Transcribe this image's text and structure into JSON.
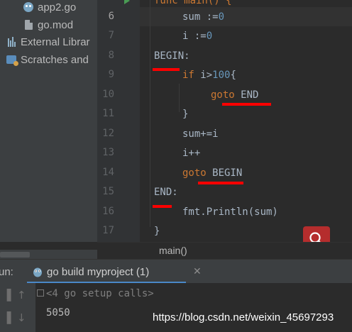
{
  "project_tree": [
    {
      "label": "app2.go",
      "icon": "go-file-icon"
    },
    {
      "label": "go.mod",
      "icon": "file-icon"
    },
    {
      "label": "External Librar",
      "icon": "external-libraries-icon"
    },
    {
      "label": "Scratches and",
      "icon": "scratches-icon"
    }
  ],
  "editor": {
    "top_partial": "func main() {",
    "line_numbers": [
      "6",
      "7",
      "8",
      "9",
      "10",
      "11",
      "12",
      "13",
      "14",
      "15",
      "16",
      "17"
    ],
    "lines": {
      "l6_a": "sum :=",
      "l6_b": "0",
      "l7_a": "i :=",
      "l7_b": "0",
      "l8": "BEGIN:",
      "l9_kw": "if",
      "l9_a": " i>",
      "l9_num": "100",
      "l9_b": "{",
      "l10_kw": "goto",
      "l10_a": " END",
      "l11": "}",
      "l12": "sum+=i",
      "l13": "i++",
      "l14_kw": "goto",
      "l14_a": " BEGIN",
      "l15": "END:",
      "l16": "fmt.Println(sum)",
      "l17": "}"
    }
  },
  "breadcrumb": "main()",
  "run_panel": {
    "label": "un:",
    "tab_label": "go build myproject (1)",
    "close_glyph": "✕"
  },
  "console": {
    "line1": "<4 go setup calls>",
    "line2": "5050"
  },
  "watermark": "https://blog.csdn.net/weixin_45697293",
  "colors": {
    "accent": "#4a88c7",
    "annotation": "#ff0000",
    "keyword": "#cc7832",
    "number": "#6897bb"
  }
}
